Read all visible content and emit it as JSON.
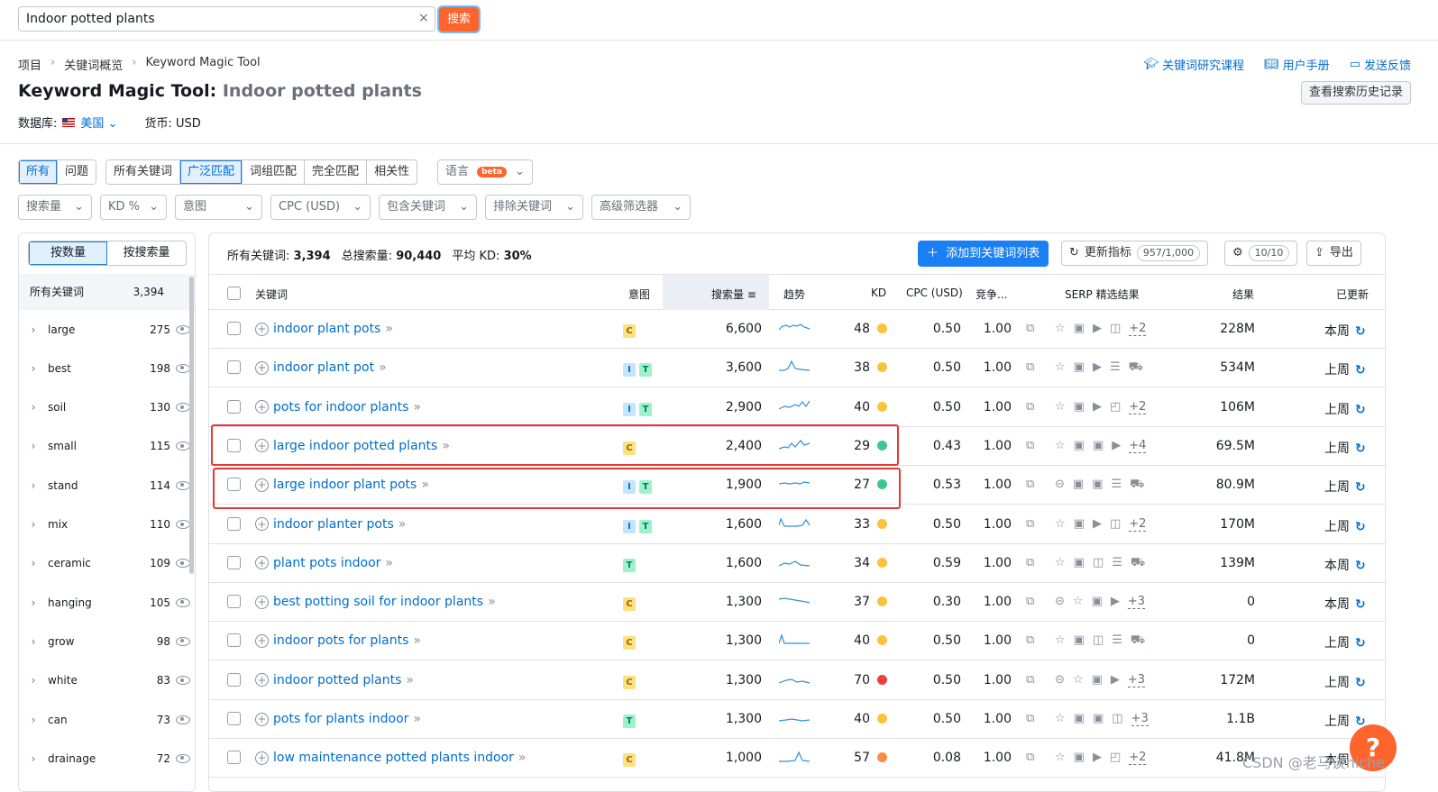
{
  "search": {
    "value": "Indoor potted plants",
    "button": "搜索",
    "clear": "×"
  },
  "breadcrumb": [
    "项目",
    "关键词概览",
    "Keyword Magic Tool"
  ],
  "title": {
    "tool": "Keyword Magic Tool:",
    "keyword": "Indoor potted plants"
  },
  "database": {
    "label": "数据库:",
    "value": "美国",
    "currency": "货币: USD"
  },
  "toplinks": [
    "关键词研究课程",
    "用户手册",
    "发送反馈"
  ],
  "history_button": "查看搜索历史记录",
  "match_tabs": {
    "group1": [
      "所有",
      "问题"
    ],
    "group2": [
      "所有关键词",
      "广泛匹配",
      "词组匹配",
      "完全匹配",
      "相关性"
    ],
    "language": "语言",
    "beta": "beta"
  },
  "filters": [
    "搜索量",
    "KD %",
    "意图",
    "CPC (USD)",
    "包含关键词",
    "排除关键词",
    "高级筛选器"
  ],
  "sidebar": {
    "toggle": [
      "按数量",
      "按搜索量"
    ],
    "header_label": "所有关键词",
    "header_count": "3,394",
    "items": [
      {
        "label": "large",
        "count": "275"
      },
      {
        "label": "best",
        "count": "198"
      },
      {
        "label": "soil",
        "count": "130"
      },
      {
        "label": "small",
        "count": "115"
      },
      {
        "label": "stand",
        "count": "114"
      },
      {
        "label": "mix",
        "count": "110"
      },
      {
        "label": "ceramic",
        "count": "109"
      },
      {
        "label": "hanging",
        "count": "105"
      },
      {
        "label": "grow",
        "count": "98"
      },
      {
        "label": "white",
        "count": "83"
      },
      {
        "label": "can",
        "count": "73"
      },
      {
        "label": "drainage",
        "count": "72"
      }
    ]
  },
  "summary": {
    "all_label": "所有关键词:",
    "all_value": "3,394",
    "vol_label": "总搜索量:",
    "vol_value": "90,440",
    "kd_label": "平均 KD:",
    "kd_value": "30%"
  },
  "toolbar": {
    "add": "添加到关键词列表",
    "update": "更新指标",
    "quota": "957/1,000",
    "settings_count": "10/10",
    "export": "导出"
  },
  "columns": [
    "关键词",
    "意图",
    "搜索量",
    "趋势",
    "KD",
    "CPC (USD)",
    "竞争...",
    "SERP 精选结果",
    "结果",
    "已更新"
  ],
  "rows": [
    {
      "kw": "indoor plant pots",
      "intent": [
        "C"
      ],
      "volume": "6,600",
      "kd": "48",
      "kdcolor": "#fdc23c",
      "cpc": "0.50",
      "comp": "1.00",
      "serp": [
        "☆",
        "▣",
        "▶",
        "◫"
      ],
      "more": "+2",
      "results": "228M",
      "updated": "本周"
    },
    {
      "kw": "indoor plant pot",
      "intent": [
        "I",
        "T"
      ],
      "volume": "3,600",
      "kd": "38",
      "kdcolor": "#fdc23c",
      "cpc": "0.50",
      "comp": "1.00",
      "serp": [
        "☆",
        "▣",
        "▶",
        "☰",
        "⛟"
      ],
      "more": "",
      "results": "534M",
      "updated": "上周"
    },
    {
      "kw": "pots for indoor plants",
      "intent": [
        "I",
        "T"
      ],
      "volume": "2,900",
      "kd": "40",
      "kdcolor": "#fdc23c",
      "cpc": "0.50",
      "comp": "1.00",
      "serp": [
        "☆",
        "▣",
        "▶",
        "◰"
      ],
      "more": "+2",
      "results": "106M",
      "updated": "上周"
    },
    {
      "kw": "large indoor potted plants",
      "intent": [
        "C"
      ],
      "volume": "2,400",
      "kd": "29",
      "kdcolor": "#3ec78c",
      "cpc": "0.43",
      "comp": "1.00",
      "serp": [
        "☆",
        "▣",
        "▣",
        "▶"
      ],
      "more": "+4",
      "results": "69.5M",
      "updated": "上周"
    },
    {
      "kw": "large indoor plant pots",
      "intent": [
        "I",
        "T"
      ],
      "volume": "1,900",
      "kd": "27",
      "kdcolor": "#3ec78c",
      "cpc": "0.53",
      "comp": "1.00",
      "serp": [
        "⊝",
        "▣",
        "▣",
        "☰",
        "⛟"
      ],
      "more": "",
      "results": "80.9M",
      "updated": "上周"
    },
    {
      "kw": "indoor planter pots",
      "intent": [
        "I",
        "T"
      ],
      "volume": "1,600",
      "kd": "33",
      "kdcolor": "#fdc23c",
      "cpc": "0.50",
      "comp": "1.00",
      "serp": [
        "☆",
        "▣",
        "▶",
        "◫"
      ],
      "more": "+2",
      "results": "170M",
      "updated": "上周"
    },
    {
      "kw": "plant pots indoor",
      "intent": [
        "T"
      ],
      "volume": "1,600",
      "kd": "34",
      "kdcolor": "#fdc23c",
      "cpc": "0.59",
      "comp": "1.00",
      "serp": [
        "☆",
        "▣",
        "◫",
        "☰",
        "⛟"
      ],
      "more": "",
      "results": "139M",
      "updated": "本周"
    },
    {
      "kw": "best potting soil for indoor plants",
      "intent": [
        "C"
      ],
      "volume": "1,300",
      "kd": "37",
      "kdcolor": "#fdc23c",
      "cpc": "0.30",
      "comp": "1.00",
      "serp": [
        "⊝",
        "☆",
        "▣",
        "▶"
      ],
      "more": "+3",
      "results": "0",
      "updated": "本周"
    },
    {
      "kw": "indoor pots for plants",
      "intent": [
        "C"
      ],
      "volume": "1,300",
      "kd": "40",
      "kdcolor": "#fdc23c",
      "cpc": "0.50",
      "comp": "1.00",
      "serp": [
        "☆",
        "▣",
        "◫",
        "☰",
        "⛟"
      ],
      "more": "",
      "results": "0",
      "updated": "上周"
    },
    {
      "kw": "indoor potted plants",
      "intent": [
        "C"
      ],
      "volume": "1,300",
      "kd": "70",
      "kdcolor": "#ed3e3e",
      "cpc": "0.50",
      "comp": "1.00",
      "serp": [
        "⊝",
        "☆",
        "▣",
        "▶"
      ],
      "more": "+3",
      "results": "172M",
      "updated": "上周"
    },
    {
      "kw": "pots for plants indoor",
      "intent": [
        "T"
      ],
      "volume": "1,300",
      "kd": "40",
      "kdcolor": "#fdc23c",
      "cpc": "0.50",
      "comp": "1.00",
      "serp": [
        "☆",
        "▣",
        "▣",
        "◫"
      ],
      "more": "+3",
      "results": "1.1B",
      "updated": "上周"
    },
    {
      "kw": "low maintenance potted plants indoor",
      "intent": [
        "C"
      ],
      "volume": "1,000",
      "kd": "57",
      "kdcolor": "#ff8c43",
      "cpc": "0.08",
      "comp": "1.00",
      "serp": [
        "☆",
        "▣",
        "▶",
        "◰"
      ],
      "more": "+2",
      "results": "41.8M",
      "updated": "本周"
    }
  ],
  "help": "?",
  "watermark": "CSDN @老马谈niche"
}
